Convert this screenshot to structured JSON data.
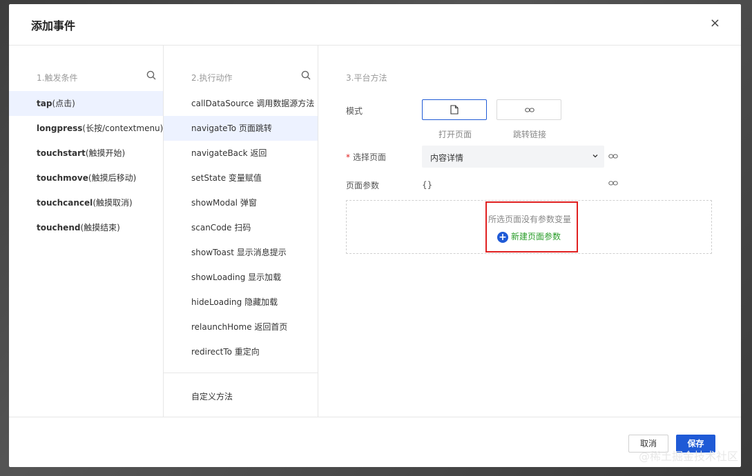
{
  "dialog": {
    "title": "添加事件",
    "close_icon": "×"
  },
  "triggers": {
    "heading": "1.触发条件",
    "items": [
      {
        "kw": "tap",
        "desc": "(点击)"
      },
      {
        "kw": "longpress",
        "desc": "(长按/contextmenu)"
      },
      {
        "kw": "touchstart",
        "desc": "(触摸开始)"
      },
      {
        "kw": "touchmove",
        "desc": "(触摸后移动)"
      },
      {
        "kw": "touchcancel",
        "desc": "(触摸取消)"
      },
      {
        "kw": "touchend",
        "desc": "(触摸结束)"
      }
    ],
    "selected_index": 0
  },
  "actions": {
    "heading": "2.执行动作",
    "items": [
      "callDataSource 调用数据源方法",
      "navigateTo 页面跳转",
      "navigateBack 返回",
      "setState 变量赋值",
      "showModal 弹窗",
      "scanCode 扫码",
      "showToast 显示消息提示",
      "showLoading 显示加载",
      "hideLoading 隐藏加载",
      "relaunchHome 返回首页",
      "redirectTo 重定向"
    ],
    "selected_index": 1,
    "custom_method": "自定义方法"
  },
  "platform": {
    "heading": "3.平台方法",
    "mode_label": "模式",
    "mode_open_page": "打开页面",
    "mode_jump_link": "跳转链接",
    "select_page_label": "选择页面",
    "select_page_value": "内容详情",
    "page_params_label": "页面参数",
    "page_params_value": "{}",
    "empty_params_msg": "所选页面没有参数变量",
    "new_param_label": "新建页面参数"
  },
  "footer": {
    "cancel": "取消",
    "save": "保存"
  },
  "watermark": "@稀土掘金技术社区",
  "colors": {
    "primary": "#1f5ad6",
    "active_row": "#edf2ff",
    "highlight_border": "#e02020",
    "new_param_text": "#2a9d2a"
  }
}
